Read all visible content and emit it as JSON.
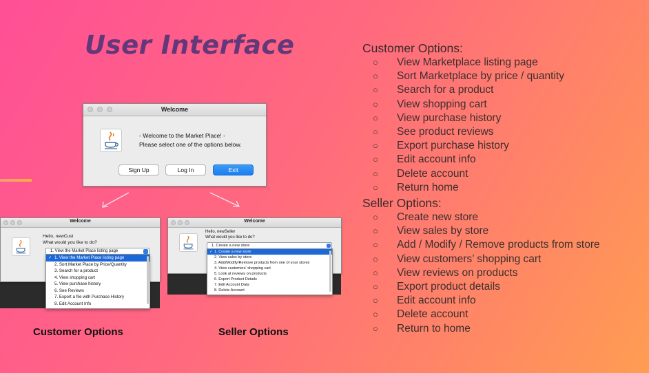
{
  "title": "User Interface",
  "welcome_window": {
    "title": "Welcome",
    "message_line1": "- Welcome to the Market Place! -",
    "message_line2": "Please select one of the options below.",
    "buttons": {
      "sign_up": "Sign Up",
      "log_in": "Log In",
      "exit": "Exit"
    }
  },
  "customer_window": {
    "title": "Welcome",
    "greeting": "Hello, newCust",
    "prompt": "What would you like to do?",
    "selected": "1. View the Market Place listing page",
    "options": [
      "1. View the Market Place listing page",
      "2. Sort Market Place by Price/Quantity",
      "3. Search for a product",
      "4. View shopping cart",
      "5. View purchase history",
      "6. See Reviews",
      "7. Export a file with Purchase History",
      "8. Edit Account Info"
    ]
  },
  "seller_window": {
    "title": "Welcome",
    "greeting": "Hello, newSeller",
    "prompt": "What would you like to do?",
    "selected": "1. Create a new store",
    "options": [
      "1. Create a new store",
      "2. View sales by store",
      "3. Add/Modify/Remove products from one of your stores",
      "4. View customers' shopping cart",
      "5. Look at reviews on products",
      "6. Export Product Details",
      "7. Edit Account Data",
      "8. Delete Account"
    ]
  },
  "captions": {
    "customer": "Customer Options",
    "seller": "Seller Options"
  },
  "customer_options": {
    "heading": "Customer Options:",
    "bullet": "○",
    "items": [
      "View Marketplace listing page",
      "Sort Marketplace by price / quantity",
      "Search for a product",
      "View shopping cart",
      "View purchase history",
      "See product reviews",
      "Export purchase history",
      "Edit account info",
      "Delete account",
      "Return home"
    ]
  },
  "seller_options": {
    "heading": "Seller Options:",
    "bullet": "○",
    "items": [
      "Create new store",
      "View sales by store",
      "Add / Modify / Remove products from store",
      "View customers’ shopping cart",
      "View reviews on products",
      "Export product details",
      "Edit account info",
      "Delete account",
      "Return to home"
    ]
  },
  "icons": {
    "app_icon": "java-coffee-cup-icon",
    "window_controls": "traffic-light-dots"
  },
  "colors": {
    "title": "#63387a",
    "primary_button": "#1b7ef0",
    "selection": "#1d68d8"
  }
}
